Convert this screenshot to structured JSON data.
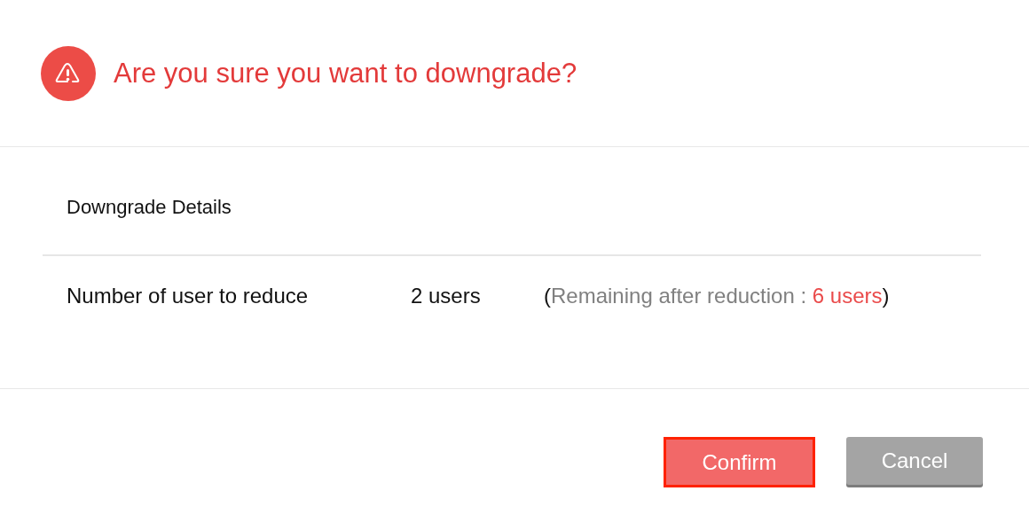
{
  "dialog": {
    "title": "Are you sure you want to downgrade?"
  },
  "details": {
    "heading": "Downgrade Details",
    "rows": [
      {
        "label": "Number of user to reduce",
        "value": "2 users",
        "note": {
          "open": "(",
          "text": "Remaining after reduction : ",
          "count": "6 users",
          "close": ")"
        }
      }
    ]
  },
  "buttons": [
    {
      "label": "Confirm",
      "kind": "primary",
      "focused": true
    },
    {
      "label": "Cancel",
      "kind": "secondary",
      "focused": false
    }
  ]
}
